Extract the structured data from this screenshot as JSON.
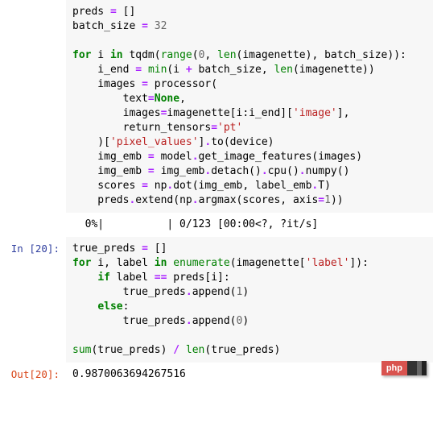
{
  "cell1": {
    "prompt": "",
    "lines": {
      "l1a": "preds ",
      "l1b": "=",
      "l1c": " []",
      "l2a": "batch_size ",
      "l2b": "=",
      "l2c": " ",
      "l2d": "32",
      "l4a": "for",
      "l4b": " i ",
      "l4c": "in",
      "l4d": " tqdm(",
      "l4e": "range",
      "l4f": "(",
      "l4g": "0",
      "l4h": ", ",
      "l4i": "len",
      "l4j": "(imagenette), batch_size)):",
      "l5a": "    i_end ",
      "l5b": "=",
      "l5c": " ",
      "l5d": "min",
      "l5e": "(i ",
      "l5f": "+",
      "l5g": " batch_size, ",
      "l5h": "len",
      "l5i": "(imagenette))",
      "l6a": "    images ",
      "l6b": "=",
      "l6c": " processor(",
      "l7a": "        text",
      "l7b": "=",
      "l7c": "None",
      "l7d": ",",
      "l8a": "        images",
      "l8b": "=",
      "l8c": "imagenette[i:i_end][",
      "l8d": "'image'",
      "l8e": "],",
      "l9a": "        return_tensors",
      "l9b": "=",
      "l9c": "'pt'",
      "l10a": "    )[",
      "l10b": "'pixel_values'",
      "l10c": "]",
      "l10d": ".",
      "l10e": "to(device)",
      "l11a": "    img_emb ",
      "l11b": "=",
      "l11c": " model",
      "l11d": ".",
      "l11e": "get_image_features(images)",
      "l12a": "    img_emb ",
      "l12b": "=",
      "l12c": " img_emb",
      "l12d": ".",
      "l12e": "detach()",
      "l12f": ".",
      "l12g": "cpu()",
      "l12h": ".",
      "l12i": "numpy()",
      "l13a": "    scores ",
      "l13b": "=",
      "l13c": " np",
      "l13d": ".",
      "l13e": "dot(img_emb, label_emb",
      "l13f": ".",
      "l13g": "T)",
      "l14a": "    preds",
      "l14b": ".",
      "l14c": "extend(np",
      "l14d": ".",
      "l14e": "argmax(scores, axis",
      "l14f": "=",
      "l14g": "1",
      "l14h": "))"
    }
  },
  "cell1_out": {
    "text": "  0%|          | 0/123 [00:00<?, ?it/s]"
  },
  "cell2": {
    "prompt": "In [20]:",
    "lines": {
      "l1a": "true_preds ",
      "l1b": "=",
      "l1c": " []",
      "l2a": "for",
      "l2b": " i, label ",
      "l2c": "in",
      "l2d": " ",
      "l2e": "enumerate",
      "l2f": "(imagenette[",
      "l2g": "'label'",
      "l2h": "]):",
      "l3a": "    ",
      "l3b": "if",
      "l3c": " label ",
      "l3d": "==",
      "l3e": " preds[i]:",
      "l4a": "        true_preds",
      "l4b": ".",
      "l4c": "append(",
      "l4d": "1",
      "l4e": ")",
      "l5a": "    ",
      "l5b": "else",
      "l5c": ":",
      "l6a": "        true_preds",
      "l6b": ".",
      "l6c": "append(",
      "l6d": "0",
      "l6e": ")",
      "l8a": "sum",
      "l8b": "(true_preds) ",
      "l8c": "/",
      "l8d": " ",
      "l8e": "len",
      "l8f": "(true_preds)"
    }
  },
  "cell2_out": {
    "prompt": "Out[20]:",
    "text": "0.9870063694267516"
  },
  "logo": {
    "text": "php"
  },
  "chart_data": {
    "type": "table",
    "title": "Jupyter notebook code cells – CLIP zero-shot classification on Imagenette",
    "cells": [
      {
        "cell": "code (continuation)",
        "source": "preds = []\nbatch_size = 32\n\nfor i in tqdm(range(0, len(imagenette), batch_size)):\n    i_end = min(i + batch_size, len(imagenette))\n    images = processor(\n        text=None,\n        images=imagenette[i:i_end]['image'],\n        return_tensors='pt'\n    )['pixel_values'].to(device)\n    img_emb = model.get_image_features(images)\n    img_emb = img_emb.detach().cpu().numpy()\n    scores = np.dot(img_emb, label_emb.T)\n    preds.extend(np.argmax(scores, axis=1))",
        "stdout": "  0%|          | 0/123 [00:00<?, ?it/s]"
      },
      {
        "cell": "In [20]",
        "source": "true_preds = []\nfor i, label in enumerate(imagenette['label']):\n    if label == preds[i]:\n        true_preds.append(1)\n    else:\n        true_preds.append(0)\n\nsum(true_preds) / len(true_preds)",
        "result": 0.9870063694267516
      }
    ]
  }
}
